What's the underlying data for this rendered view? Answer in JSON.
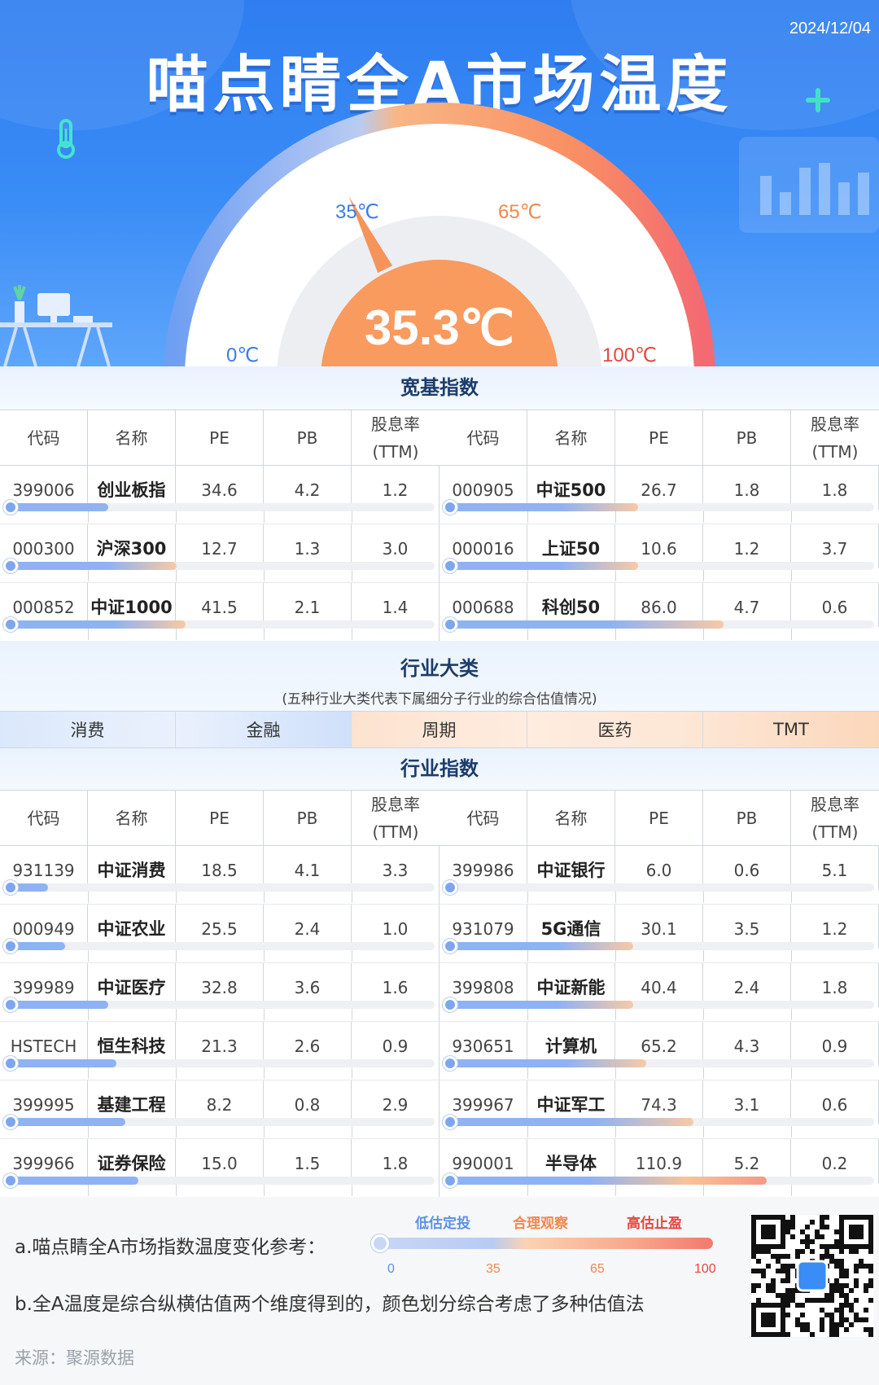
{
  "header": {
    "date": "2024/12/04",
    "title": "喵点睛全A市场温度",
    "temperature": "35.3℃",
    "temperature_value": 35.3,
    "gauge_labels": {
      "l35": "35℃",
      "l65": "65℃",
      "l0": "0℃",
      "l100": "100℃"
    }
  },
  "broad": {
    "title": "宽基指数",
    "headers": [
      "代码",
      "名称",
      "PE",
      "PB",
      "股息率",
      "(TTM)"
    ],
    "left": [
      {
        "code": "399006",
        "name": "创业板指",
        "pe": "34.6",
        "pb": "4.2",
        "dy": "1.2",
        "temp": 24
      },
      {
        "code": "000300",
        "name": "沪深300",
        "pe": "12.7",
        "pb": "1.3",
        "dy": "3.0",
        "temp": 40
      },
      {
        "code": "000852",
        "name": "中证1000",
        "pe": "41.5",
        "pb": "2.1",
        "dy": "1.4",
        "temp": 42
      }
    ],
    "right": [
      {
        "code": "000905",
        "name": "中证500",
        "pe": "26.7",
        "pb": "1.8",
        "dy": "1.8",
        "temp": 45
      },
      {
        "code": "000016",
        "name": "上证50",
        "pe": "10.6",
        "pb": "1.2",
        "dy": "3.7",
        "temp": 45
      },
      {
        "code": "000688",
        "name": "科创50",
        "pe": "86.0",
        "pb": "4.7",
        "dy": "0.6",
        "temp": 65
      }
    ]
  },
  "category": {
    "title": "行业大类",
    "subtitle": "(五种行业大类代表下属细分子行业的综合估值情况)",
    "items": [
      "消费",
      "金融",
      "周期",
      "医药",
      "TMT"
    ]
  },
  "industry": {
    "title": "行业指数",
    "headers": [
      "代码",
      "名称",
      "PE",
      "PB",
      "股息率",
      "(TTM)"
    ],
    "left": [
      {
        "code": "931139",
        "name": "中证消费",
        "pe": "18.5",
        "pb": "4.1",
        "dy": "3.3",
        "temp": 10
      },
      {
        "code": "000949",
        "name": "中证农业",
        "pe": "25.5",
        "pb": "2.4",
        "dy": "1.0",
        "temp": 14
      },
      {
        "code": "399989",
        "name": "中证医疗",
        "pe": "32.8",
        "pb": "3.6",
        "dy": "1.6",
        "temp": 24
      },
      {
        "code": "HSTECH",
        "name": "恒生科技",
        "pe": "21.3",
        "pb": "2.6",
        "dy": "0.9",
        "temp": 26
      },
      {
        "code": "399995",
        "name": "基建工程",
        "pe": "8.2",
        "pb": "0.8",
        "dy": "2.9",
        "temp": 28
      },
      {
        "code": "399966",
        "name": "证券保险",
        "pe": "15.0",
        "pb": "1.5",
        "dy": "1.8",
        "temp": 31
      }
    ],
    "right": [
      {
        "code": "399986",
        "name": "中证银行",
        "pe": "6.0",
        "pb": "0.6",
        "dy": "5.1",
        "temp": 3
      },
      {
        "code": "931079",
        "name": "5G通信",
        "pe": "30.1",
        "pb": "3.5",
        "dy": "1.2",
        "temp": 44
      },
      {
        "code": "399808",
        "name": "中证新能",
        "pe": "40.4",
        "pb": "2.4",
        "dy": "1.8",
        "temp": 44
      },
      {
        "code": "930651",
        "name": "计算机",
        "pe": "65.2",
        "pb": "4.3",
        "dy": "0.9",
        "temp": 47
      },
      {
        "code": "399967",
        "name": "中证军工",
        "pe": "74.3",
        "pb": "3.1",
        "dy": "0.6",
        "temp": 58
      },
      {
        "code": "990001",
        "name": "半导体",
        "pe": "110.9",
        "pb": "5.2",
        "dy": "0.2",
        "temp": 75
      }
    ]
  },
  "footer": {
    "note_a": "a.喵点睛全A市场指数温度变化参考：",
    "note_b": "b.全A温度是综合纵横估值两个维度得到的，颜色划分综合考虑了多种估值法",
    "scale_low": "低估定投",
    "scale_mid": "合理观察",
    "scale_high": "高估止盈",
    "n0": "0",
    "n35": "35",
    "n65": "65",
    "n100": "100",
    "source": "来源：聚源数据"
  },
  "colors": {
    "blue": "#8fb2f3",
    "orange": "#f7c39a",
    "red": "#f27a6e",
    "header": "#3a8cf6"
  }
}
